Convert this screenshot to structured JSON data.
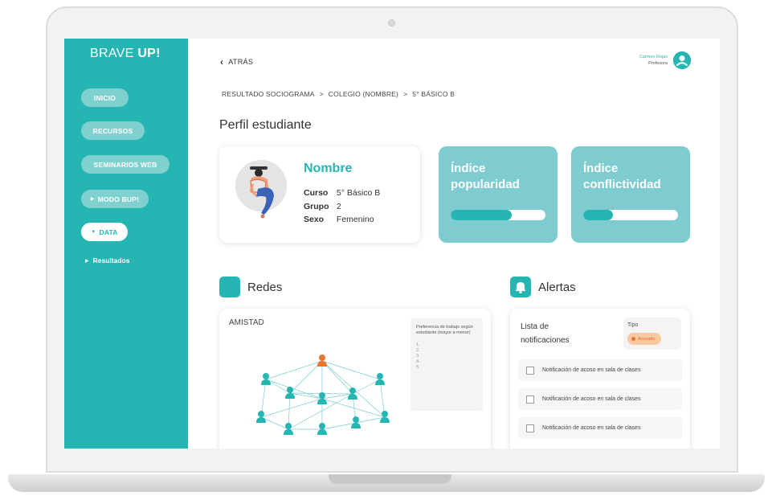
{
  "sidebar": {
    "logo_light": "BRAVE ",
    "logo_bold": "UP!",
    "items": [
      {
        "label": "INICIO"
      },
      {
        "label": "RECURSOS"
      },
      {
        "label": "SEMINARIOS WEB"
      },
      {
        "label": "MODO BUP!"
      },
      {
        "label": "DATA"
      }
    ],
    "sub_item": "Resultados"
  },
  "header": {
    "back_label": "ATRÁS",
    "user_name": "Carmen Rojas",
    "user_role": "Profesora"
  },
  "breadcrumb": [
    "RESULTADO SOCIOGRAMA",
    ">",
    "COLEGIO (NOMBRE)",
    ">",
    "5° BÁSICO B"
  ],
  "page_title": "Perfil estudiante",
  "student": {
    "name": "Nombre",
    "curso_label": "Curso",
    "curso_value": "5° Básico B",
    "grupo_label": "Grupo",
    "grupo_value": "2",
    "sexo_label": "Sexo",
    "sexo_value": "Femenino"
  },
  "indices": [
    {
      "title_line1": "Índice",
      "title_line2": "popularidad",
      "fraction": 0.64
    },
    {
      "title_line1": "Índice",
      "title_line2": "conflictividad",
      "fraction": 0.31
    }
  ],
  "redes": {
    "title": "Redes",
    "graph_title": "AMISTAD",
    "pref_title": "Preferencia de trabajo según estudiante (mayor a menor)",
    "pref_items": [
      "1.",
      "2.",
      "3.",
      "4.",
      "5."
    ]
  },
  "alertas": {
    "title": "Alertas",
    "list_title_1": "Lista de",
    "list_title_2": "notificaciones",
    "tipo_label": "Tipo",
    "badge": "Acosado",
    "notifications": [
      "Notificación de acoso en sala de clases",
      "Notificación de acoso en sala de clases",
      "Notificación de acoso en sala de clases"
    ]
  },
  "colors": {
    "brand": "#25b5b2",
    "card_light": "#7ecbd0",
    "highlight_node": "#e9752f"
  }
}
